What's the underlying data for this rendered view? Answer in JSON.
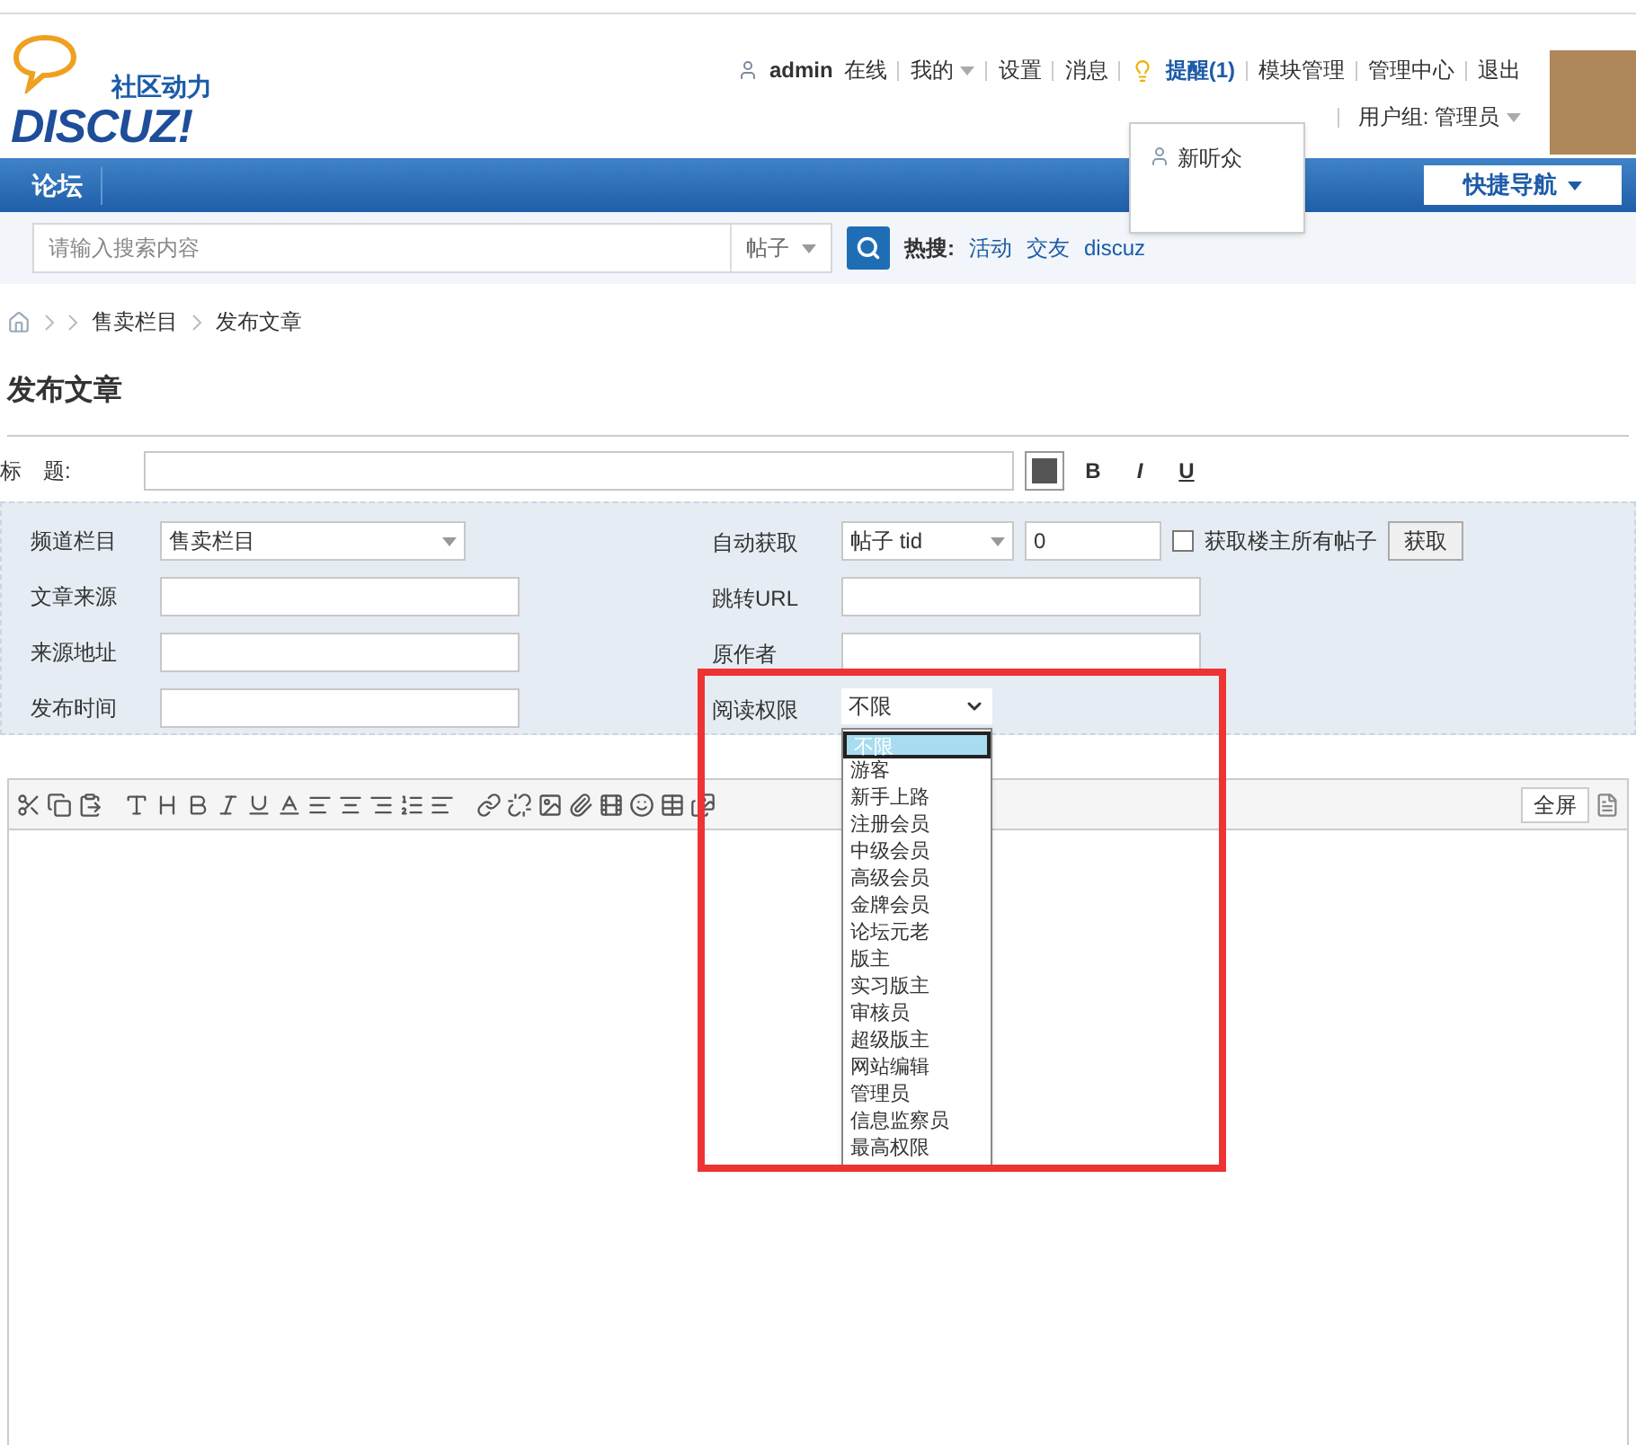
{
  "header": {
    "tagline": "社区动力",
    "logo": "DISCUZ!",
    "user": "admin",
    "status": "在线",
    "links": [
      {
        "label": "我的",
        "dropdown": true
      },
      {
        "label": "设置",
        "dropdown": false
      },
      {
        "label": "消息",
        "dropdown": false
      },
      {
        "label": "提醒(1)",
        "dropdown": false,
        "kind": "alert"
      },
      {
        "label": "模块管理",
        "dropdown": false
      },
      {
        "label": "管理中心",
        "dropdown": false
      },
      {
        "label": "退出",
        "dropdown": false
      }
    ],
    "user_group": "用户组: 管理员"
  },
  "popup": {
    "items": [
      "新听众"
    ]
  },
  "nav": {
    "items": [
      {
        "label": "论坛",
        "selected": true
      }
    ],
    "quick_nav": "快捷导航"
  },
  "search": {
    "placeholder": "请输入搜索内容",
    "type": "帖子",
    "hot_label": "热搜:",
    "hot": [
      "活动",
      "交友",
      "discuz"
    ]
  },
  "breadcrumb": [
    "售卖栏目",
    "发布文章"
  ],
  "page_title": "发布文章",
  "title_field": {
    "label": "标　题:",
    "format_buttons": [
      "B",
      "I",
      "U"
    ]
  },
  "form": {
    "left": [
      {
        "label": "频道栏目",
        "kind": "select",
        "value": "售卖栏目"
      },
      {
        "label": "文章来源",
        "kind": "text"
      },
      {
        "label": "来源地址",
        "kind": "text"
      },
      {
        "label": "发布时间",
        "kind": "text"
      }
    ],
    "right": [
      {
        "label": "自动获取",
        "kind": "fetch",
        "select": "帖子 tid",
        "value": "0",
        "checkbox_label": "获取楼主所有帖子",
        "checked": false,
        "button": "获取"
      },
      {
        "label": "跳转URL",
        "kind": "text"
      },
      {
        "label": "原作者",
        "kind": "text"
      },
      {
        "label": "阅读权限",
        "kind": "dropdown",
        "value": "不限",
        "options": [
          {
            "label": "不限",
            "selected": true
          },
          {
            "label": "游客",
            "selected": false
          },
          {
            "label": "新手上路",
            "selected": false
          },
          {
            "label": "注册会员",
            "selected": false
          },
          {
            "label": "中级会员",
            "selected": false
          },
          {
            "label": "高级会员",
            "selected": false
          },
          {
            "label": "金牌会员",
            "selected": false
          },
          {
            "label": "论坛元老",
            "selected": false
          },
          {
            "label": "版主",
            "selected": false
          },
          {
            "label": "实习版主",
            "selected": false
          },
          {
            "label": "审核员",
            "selected": false
          },
          {
            "label": "超级版主",
            "selected": false
          },
          {
            "label": "网站编辑",
            "selected": false
          },
          {
            "label": "管理员",
            "selected": false
          },
          {
            "label": "信息监察员",
            "selected": false
          },
          {
            "label": "最高权限",
            "selected": false
          }
        ]
      }
    ]
  },
  "editor": {
    "fullscreen": "全屏"
  }
}
